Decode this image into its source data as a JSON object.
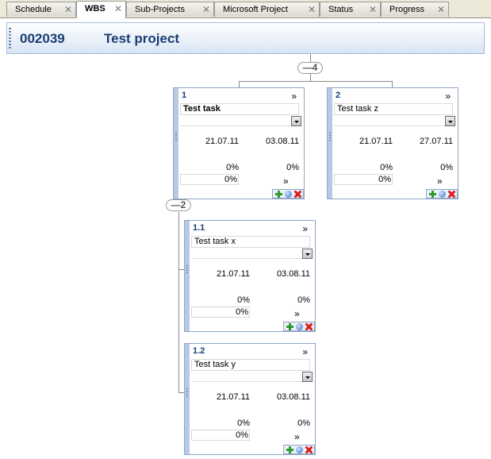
{
  "tabs": [
    {
      "label": "Schedule"
    },
    {
      "label": "WBS"
    },
    {
      "label": "Sub-Projects"
    },
    {
      "label": "Microsoft Project"
    },
    {
      "label": "Status"
    },
    {
      "label": "Progress"
    }
  ],
  "active_tab": "WBS",
  "project": {
    "id": "002039",
    "name": "Test project"
  },
  "root_badge": "—4",
  "child_badge": "—2",
  "tasks": [
    {
      "number": "1",
      "name": "Test task",
      "start": "21.07.11",
      "end": "03.08.11",
      "pct_a": "0%",
      "pct_b": "0%",
      "pct_c": "0%"
    },
    {
      "number": "2",
      "name": "Test task z",
      "start": "21.07.11",
      "end": "27.07.11",
      "pct_a": "0%",
      "pct_b": "0%",
      "pct_c": "0%"
    },
    {
      "number": "1.1",
      "name": "Test task x",
      "start": "21.07.11",
      "end": "03.08.11",
      "pct_a": "0%",
      "pct_b": "0%",
      "pct_c": "0%"
    },
    {
      "number": "1.2",
      "name": "Test task y",
      "start": "21.07.11",
      "end": "03.08.11",
      "pct_a": "0%",
      "pct_b": "0%",
      "pct_c": "0%"
    }
  ],
  "glyphs": {
    "expand": "»",
    "close": "✕"
  },
  "icons": [
    "add-icon",
    "details-icon",
    "delete-icon",
    "grip-icon",
    "dropdown-arrow-icon",
    "close-tab-icon"
  ],
  "colors": {
    "accent": "#123e7c",
    "header_band": "#d8e4f4",
    "card_border": "#8fa6c8",
    "card_strip": "#b9c9e4"
  }
}
